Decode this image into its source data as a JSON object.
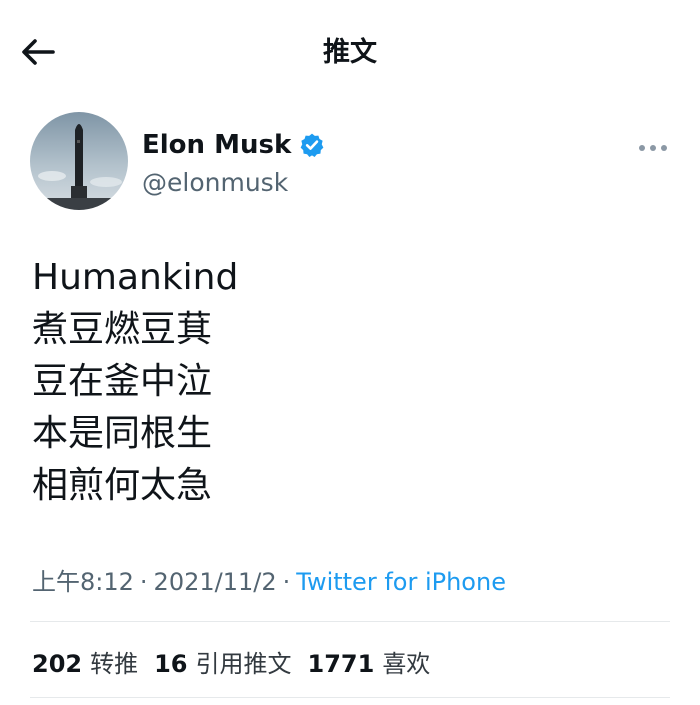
{
  "header": {
    "title": "推文",
    "back_icon": "back-arrow-icon"
  },
  "author": {
    "display_name": "Elon Musk",
    "handle": "@elonmusk",
    "verified_icon": "verified-badge-icon",
    "verified_color": "#1d9bf0",
    "more_icon": "more-options-icon"
  },
  "tweet": {
    "lines": [
      "Humankind",
      "煮豆燃豆萁",
      "豆在釜中泣",
      "本是同根生",
      "相煎何太急"
    ]
  },
  "meta": {
    "time": "上午8:12",
    "separator": "·",
    "date": "2021/11/2",
    "source": "Twitter for iPhone",
    "source_color": "#1d9bf0"
  },
  "stats": {
    "retweets": {
      "count": "202",
      "label": "转推"
    },
    "quotes": {
      "count": "16",
      "label": "引用推文"
    },
    "likes": {
      "count": "1771",
      "label": "喜欢"
    }
  }
}
